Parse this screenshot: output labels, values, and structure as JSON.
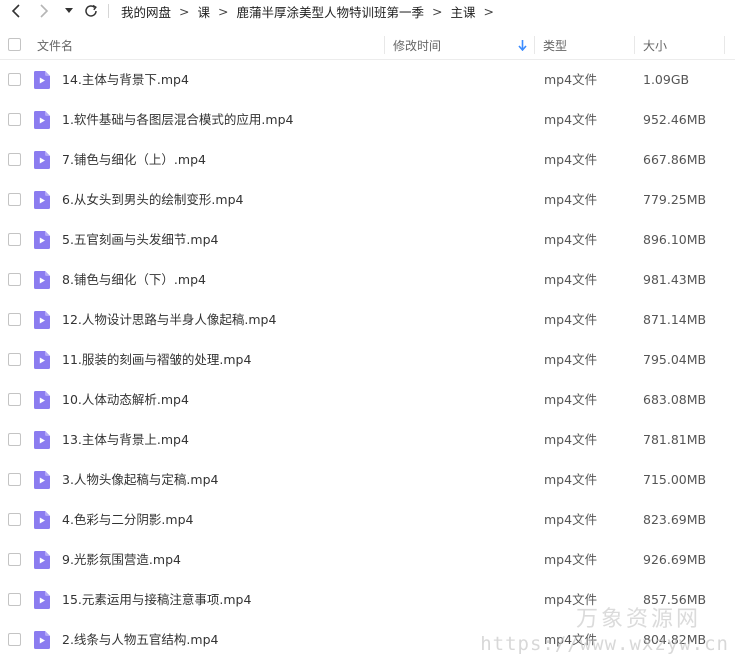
{
  "breadcrumb": {
    "items": [
      "我的网盘",
      "课",
      "鹿蒲半厚涂美型人物特训班第一季",
      "主课"
    ],
    "separator": ">"
  },
  "table": {
    "columns": {
      "name": "文件名",
      "modified": "修改时间",
      "type": "类型",
      "size": "大小"
    },
    "rows": [
      {
        "name": "14.主体与背景下.mp4",
        "type": "mp4文件",
        "size": "1.09GB"
      },
      {
        "name": "1.软件基础与各图层混合模式的应用.mp4",
        "type": "mp4文件",
        "size": "952.46MB"
      },
      {
        "name": "7.铺色与细化（上）.mp4",
        "type": "mp4文件",
        "size": "667.86MB"
      },
      {
        "name": "6.从女头到男头的绘制变形.mp4",
        "type": "mp4文件",
        "size": "779.25MB"
      },
      {
        "name": "5.五官刻画与头发细节.mp4",
        "type": "mp4文件",
        "size": "896.10MB"
      },
      {
        "name": "8.铺色与细化（下）.mp4",
        "type": "mp4文件",
        "size": "981.43MB"
      },
      {
        "name": "12.人物设计思路与半身人像起稿.mp4",
        "type": "mp4文件",
        "size": "871.14MB"
      },
      {
        "name": "11.服装的刻画与褶皱的处理.mp4",
        "type": "mp4文件",
        "size": "795.04MB"
      },
      {
        "name": "10.人体动态解析.mp4",
        "type": "mp4文件",
        "size": "683.08MB"
      },
      {
        "name": "13.主体与背景上.mp4",
        "type": "mp4文件",
        "size": "781.81MB"
      },
      {
        "name": "3.人物头像起稿与定稿.mp4",
        "type": "mp4文件",
        "size": "715.00MB"
      },
      {
        "name": "4.色彩与二分阴影.mp4",
        "type": "mp4文件",
        "size": "823.69MB"
      },
      {
        "name": "9.光影氛围营造.mp4",
        "type": "mp4文件",
        "size": "926.69MB"
      },
      {
        "name": "15.元素运用与接稿注意事项.mp4",
        "type": "mp4文件",
        "size": "857.56MB"
      },
      {
        "name": "2.线条与人物五官结构.mp4",
        "type": "mp4文件",
        "size": "804.82MB"
      }
    ]
  },
  "watermark": {
    "line1": "万象资源网",
    "line2": "https://www.wxzyw.cn"
  },
  "colors": {
    "video_icon": "#8b7cf0",
    "sort_arrow": "#3b8cff",
    "row_divider": "#f2f2f2"
  },
  "icons": {
    "back": "chevron-left-icon",
    "forward": "chevron-right-icon",
    "history_menu": "caret-down-icon",
    "refresh": "refresh-icon",
    "sort": "sort-desc-arrow-icon",
    "file": "video-file-icon"
  }
}
